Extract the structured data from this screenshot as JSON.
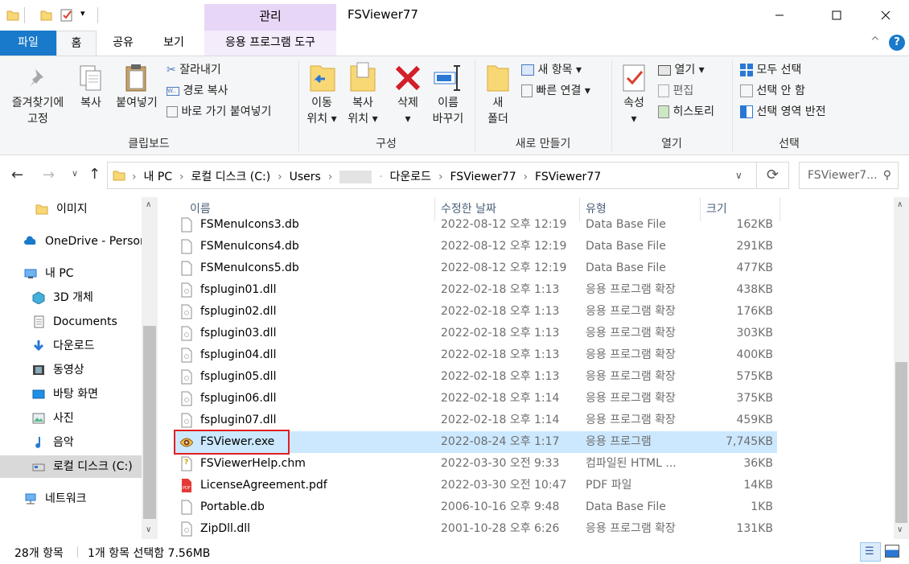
{
  "window": {
    "title": "FSViewer77",
    "context_group": "관리"
  },
  "ribbon_tabs": {
    "file": "파일",
    "home": "홈",
    "share": "공유",
    "view": "보기",
    "app_tools": "응용 프로그램 도구"
  },
  "ribbon": {
    "clipboard": {
      "label": "클립보드",
      "pin": "즐겨찾기에\n고정",
      "pin_l1": "즐겨찾기에",
      "pin_l2": "고정",
      "copy": "복사",
      "paste": "붙여넣기",
      "cut": "잘라내기",
      "copy_path": "경로 복사",
      "paste_shortcut": "바로 가기 붙여넣기"
    },
    "organize": {
      "label": "구성",
      "move_l1": "이동",
      "move_l2": "위치",
      "copy_l1": "복사",
      "copy_l2": "위치",
      "delete": "삭제",
      "rename_l1": "이름",
      "rename_l2": "바꾸기"
    },
    "new": {
      "label": "새로 만들기",
      "folder_l1": "새",
      "folder_l2": "폴더",
      "new_item": "새 항목",
      "easy_access": "빠른 연결"
    },
    "open": {
      "label": "열기",
      "properties": "속성",
      "open": "열기",
      "edit": "편집",
      "history": "히스토리"
    },
    "select": {
      "label": "선택",
      "all": "모두 선택",
      "none": "선택 안 함",
      "invert": "선택 영역 반전"
    }
  },
  "address": {
    "crumbs": [
      "내 PC",
      "로컬 디스크 (C:)",
      "Users",
      "",
      "다운로드",
      "FSViewer77",
      "FSViewer77"
    ],
    "search_placeholder": "FSViewer7..."
  },
  "nav": {
    "items": [
      {
        "label": "이미지",
        "icon": "folder-icon"
      },
      {
        "label": "OneDrive - Personal",
        "icon": "cloud-icon"
      },
      {
        "label": "내 PC",
        "icon": "pc-icon"
      },
      {
        "label": "3D 개체",
        "icon": "cube-icon"
      },
      {
        "label": "Documents",
        "icon": "document-icon"
      },
      {
        "label": "다운로드",
        "icon": "download-icon"
      },
      {
        "label": "동영상",
        "icon": "video-icon"
      },
      {
        "label": "바탕 화면",
        "icon": "desktop-icon"
      },
      {
        "label": "사진",
        "icon": "picture-icon"
      },
      {
        "label": "음악",
        "icon": "music-icon"
      },
      {
        "label": "로컬 디스크 (C:)",
        "icon": "drive-icon"
      },
      {
        "label": "네트워크",
        "icon": "network-icon"
      }
    ]
  },
  "columns": {
    "name": "이름",
    "date": "수정한 날짜",
    "type": "유형",
    "size": "크기"
  },
  "files": [
    {
      "name": "FSMenuIcons3.db",
      "date": "2022-08-12 오후 12:19",
      "type": "Data Base File",
      "size": "162KB",
      "icon": "file-icon"
    },
    {
      "name": "FSMenuIcons4.db",
      "date": "2022-08-12 오후 12:19",
      "type": "Data Base File",
      "size": "291KB",
      "icon": "file-icon"
    },
    {
      "name": "FSMenuIcons5.db",
      "date": "2022-08-12 오후 12:19",
      "type": "Data Base File",
      "size": "477KB",
      "icon": "file-icon"
    },
    {
      "name": "fsplugin01.dll",
      "date": "2022-02-18 오후 1:13",
      "type": "응용 프로그램 확장",
      "size": "438KB",
      "icon": "dll-icon"
    },
    {
      "name": "fsplugin02.dll",
      "date": "2022-02-18 오후 1:13",
      "type": "응용 프로그램 확장",
      "size": "176KB",
      "icon": "dll-icon"
    },
    {
      "name": "fsplugin03.dll",
      "date": "2022-02-18 오후 1:13",
      "type": "응용 프로그램 확장",
      "size": "303KB",
      "icon": "dll-icon"
    },
    {
      "name": "fsplugin04.dll",
      "date": "2022-02-18 오후 1:13",
      "type": "응용 프로그램 확장",
      "size": "400KB",
      "icon": "dll-icon"
    },
    {
      "name": "fsplugin05.dll",
      "date": "2022-02-18 오후 1:13",
      "type": "응용 프로그램 확장",
      "size": "575KB",
      "icon": "dll-icon"
    },
    {
      "name": "fsplugin06.dll",
      "date": "2022-02-18 오후 1:14",
      "type": "응용 프로그램 확장",
      "size": "375KB",
      "icon": "dll-icon"
    },
    {
      "name": "fsplugin07.dll",
      "date": "2022-02-18 오후 1:14",
      "type": "응용 프로그램 확장",
      "size": "459KB",
      "icon": "dll-icon"
    },
    {
      "name": "FSViewer.exe",
      "date": "2022-08-24 오후 1:17",
      "type": "응용 프로그램",
      "size": "7,745KB",
      "icon": "eye-app-icon",
      "selected": true
    },
    {
      "name": "FSViewerHelp.chm",
      "date": "2022-03-30 오전 9:33",
      "type": "컴파일된 HTML ...",
      "size": "36KB",
      "icon": "help-icon"
    },
    {
      "name": "LicenseAgreement.pdf",
      "date": "2022-03-30 오전 10:47",
      "type": "PDF 파일",
      "size": "14KB",
      "icon": "pdf-icon"
    },
    {
      "name": "Portable.db",
      "date": "2006-10-16 오후 9:48",
      "type": "Data Base File",
      "size": "1KB",
      "icon": "file-icon"
    },
    {
      "name": "ZipDll.dll",
      "date": "2001-10-28 오후 6:26",
      "type": "응용 프로그램 확장",
      "size": "131KB",
      "icon": "dll-icon"
    }
  ],
  "status": {
    "count": "28개 항목",
    "selection": "1개 항목 선택함 7.56MB"
  },
  "colors": {
    "accent": "#1979ca",
    "selection": "#cce8ff",
    "highlight_box": "#e02020",
    "context": "#e8d6f7"
  }
}
